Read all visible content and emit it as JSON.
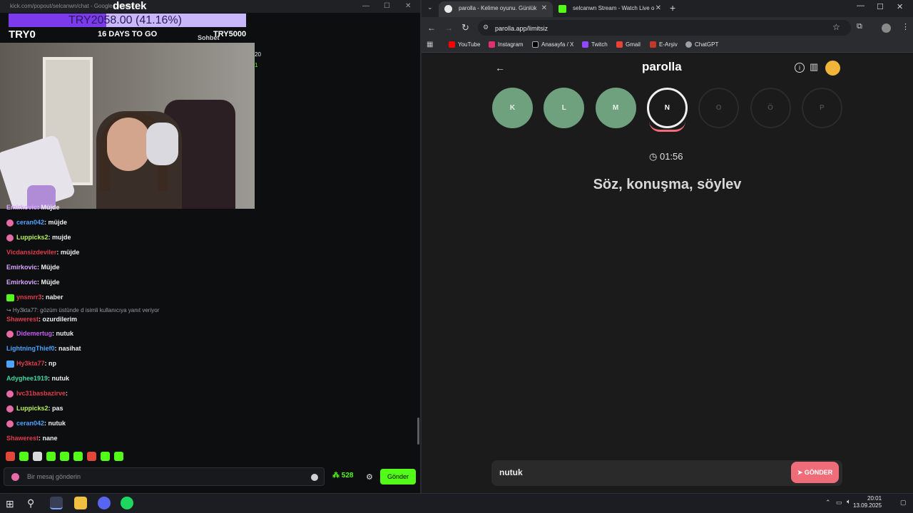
{
  "popout": {
    "url": "kick.com/popout/selcanwn/chat - Google Chrome",
    "goal_text": "TRY2058.00 (41.16%)",
    "goal_fraction": 0.4116,
    "goal_title": "destek",
    "goal_start": "TRY0",
    "goal_days": "16 DAYS TO GO",
    "goal_end": "TRY5000",
    "sohbet": "Sohbet",
    "side_num1": "20",
    "side_num2": "1"
  },
  "chat": {
    "messages": [
      {
        "user": "Emirkovic",
        "color": "#d8a6ff",
        "text": ": Müjde",
        "badge": ""
      },
      {
        "user": "ceran042",
        "color": "#4da3ff",
        "text": ": müjde",
        "badge": "#e66aa6"
      },
      {
        "user": "Luppicks2",
        "color": "#b7f05a",
        "text": ": mujde",
        "badge": "#e66aa6"
      },
      {
        "user": "Vicdansizdeviler",
        "color": "#e03c4b",
        "text": ": müjde",
        "badge": ""
      },
      {
        "user": "Emirkovic",
        "color": "#d8a6ff",
        "text": ": Müjde",
        "badge": ""
      },
      {
        "user": "Emirkovic",
        "color": "#d8a6ff",
        "text": ": Müjde",
        "badge": ""
      },
      {
        "user": "ynsmrr3",
        "color": "#e03c4b",
        "text": ": naber",
        "badge": "#53fc18"
      },
      {
        "user": "Didemertug",
        "color": "#c65cf0",
        "text": ": nutuk",
        "badge": "#e66aa6"
      },
      {
        "user": "LightningThief0",
        "color": "#4da3ff",
        "text": ": nasihat",
        "badge": ""
      },
      {
        "user": "Hy3kta77",
        "color": "#e03c4b",
        "text": ": np",
        "badge": "#4da3ff"
      },
      {
        "user": "Adyghee1919",
        "color": "#3fd6a0",
        "text": ": nutuk",
        "badge": ""
      },
      {
        "user": "lvc31basbazirve",
        "color": "#e03c4b",
        "text": ":",
        "badge": "#e66aa6"
      },
      {
        "user": "Luppicks2",
        "color": "#b7f05a",
        "text": ": pas",
        "badge": "#e66aa6"
      },
      {
        "user": "ceran042",
        "color": "#4da3ff",
        "text": ": nutuk",
        "badge": "#e66aa6"
      },
      {
        "user": "Shawerest",
        "color": "#e03c4b",
        "text": ": nane",
        "badge": ""
      }
    ],
    "reply_note": "↪ Hy3kta77: gözüm üstünde d isimli kullanıcıya yanıt veriyor",
    "reply_user": "Shawerest",
    "reply_text": ": ozurdilerim",
    "input_placeholder": "Bir mesaj gönderin",
    "points": "528",
    "send_label": "Gönder"
  },
  "browser": {
    "tab1": "parolla - Kelime oyunu. Günlük",
    "tab2": "selcanwn Stream - Watch Live o",
    "url": "parolla.app/limitsiz",
    "bookmarks": [
      "YouTube",
      "Instagram",
      "Anasayfa / X",
      "Twitch",
      "Gmail",
      "E-Arşiv",
      "ChatGPT"
    ],
    "bookmark_colors": [
      "#ff0000",
      "#e1306c",
      "#000000",
      "#9146ff",
      "#ea4335",
      "#c0392b",
      "#9aa0a6"
    ]
  },
  "game": {
    "brand": "parolla",
    "letters": [
      {
        "l": "K",
        "state": "done"
      },
      {
        "l": "L",
        "state": "done"
      },
      {
        "l": "M",
        "state": "done"
      },
      {
        "l": "N",
        "state": "current"
      },
      {
        "l": "O",
        "state": "todo"
      },
      {
        "l": "Ö",
        "state": "todo"
      },
      {
        "l": "P",
        "state": "todo"
      }
    ],
    "timer": "01:56",
    "clue": "Söz, konuşma, söylev",
    "answer": "nutuk",
    "send_label": "GÖNDER",
    "colors": {
      "done": "#6fa17f",
      "accent": "#ef6d79"
    }
  },
  "taskbar": {
    "time": "20:01",
    "date": "13.09.2025"
  }
}
